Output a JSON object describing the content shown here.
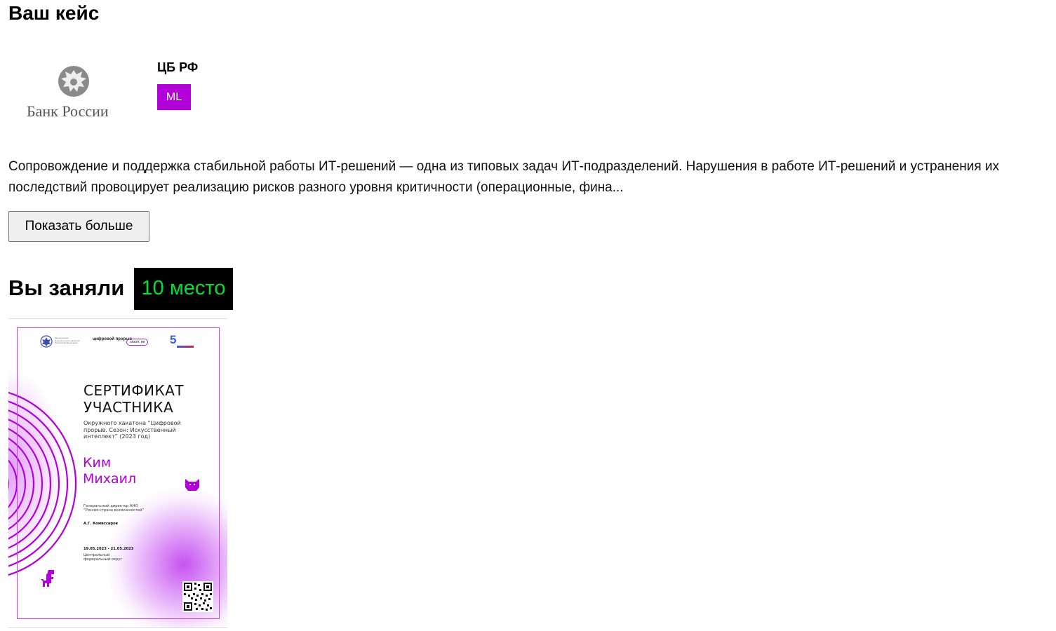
{
  "case": {
    "title": "Ваш кейс",
    "organization": {
      "logo_text": "Банк России",
      "name": "ЦБ РФ",
      "tag": "ML",
      "tag_color": "#b300d8"
    },
    "description": "Сопровождение и поддержка стабильной работы ИТ-решений — одна из типовых задач ИТ-подразделений. Нарушения в работе ИТ-решений и устранения их последствий провоцирует реализацию рисков разного уровня критичности (операционные, фина...",
    "show_more_label": "Показать больше"
  },
  "result": {
    "label": "Вы заняли",
    "place": "10 место",
    "place_bg": "#000000",
    "place_color": "#00e031"
  },
  "certificate": {
    "header_small": "Министерство экономического развития Российской Федерации",
    "brand": "цифровой прорыв",
    "season": "сезон: ии",
    "anniversary": "5",
    "title": "СЕРТИФИКАТ УЧАСТНИКА",
    "subtitle": "Окружного хакатона “Цифровой прорыв. Сезон: Искусственный интеллект” (2023 год)",
    "participant_first": "Ким",
    "participant_last": "Михаил",
    "signer_role": "Генеральный директор АНО “Россия-страна возможностей”",
    "signer_name": "А.Г. Комиссаров",
    "dates": "19.05.2023 - 21.05.2023",
    "district": "Центральный федеральный округ",
    "accent": "#b300d8"
  }
}
